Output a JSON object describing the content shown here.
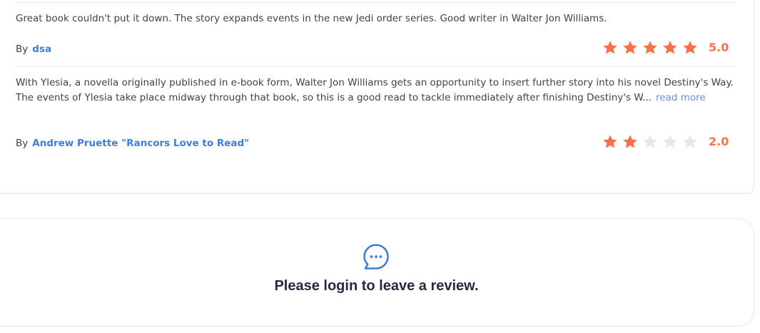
{
  "reviews": [
    {
      "text": "Great book couldn't put it down. The story expands events in the new Jedi order series. Good writer in Walter Jon Williams.",
      "by_label": "By",
      "author": "dsa",
      "rating": 5,
      "score": "5.0"
    },
    {
      "text": "With Ylesia, a novella originally published in e-book form, Walter Jon Williams gets an opportunity to insert further story into his novel Destiny's Way. The events of Ylesia take place midway through that book, so this is a good read to tackle immediately after finishing Destiny's W...",
      "read_more": "read more",
      "by_label": "By",
      "author": "Andrew Pruette \"Rancors Love to Read\"",
      "rating": 2,
      "score": "2.0"
    }
  ],
  "login_prompt": {
    "icon": "chat-bubble-icon",
    "message": "Please login to leave a review."
  },
  "colors": {
    "star_on": "#f5714a",
    "star_off": "#e8e8ea",
    "author_link": "#3c7de0",
    "read_more": "#6a8fe0",
    "heading": "#252a43"
  }
}
